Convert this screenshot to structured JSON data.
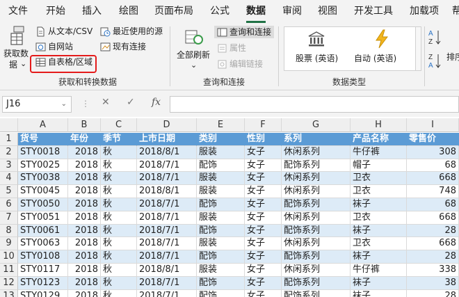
{
  "menu": {
    "tabs": [
      "文件",
      "开始",
      "插入",
      "绘图",
      "页面布局",
      "公式",
      "数据",
      "审阅",
      "视图",
      "开发工具",
      "加载项",
      "帮"
    ],
    "active_index": 6
  },
  "ribbon": {
    "get_data": {
      "label_line1": "获取数",
      "label_line2": "据",
      "chevron": "⌄"
    },
    "from_text_csv": "从文本/CSV",
    "from_web": "自网站",
    "from_table_range": "自表格/区域",
    "recent_sources": "最近使用的源",
    "existing_connections": "现有连接",
    "group_get_transform": "获取和转换数据",
    "refresh_all": {
      "label": "全部刷新",
      "chevron": "⌄"
    },
    "queries_connections": "查询和连接",
    "properties": "属性",
    "edit_links": "编辑链接",
    "group_queries": "查询和连接",
    "stocks": "股票 (英语)",
    "geography": "自动 (英语)",
    "group_data_types": "数据类型",
    "sort_az": "A\nZ",
    "sort_za": "Z\nA",
    "sort_label": "排序"
  },
  "formula_bar": {
    "name_box": "J16",
    "cancel": "✕",
    "enter": "✓",
    "fx": "fx"
  },
  "grid": {
    "columns": [
      "A",
      "B",
      "C",
      "D",
      "E",
      "F",
      "G",
      "H",
      "I"
    ],
    "row_numbers": [
      "1",
      "2",
      "3",
      "4",
      "5",
      "6",
      "7",
      "8",
      "9",
      "10",
      "11",
      "12",
      "13"
    ],
    "header": [
      "货号",
      "年份",
      "季节",
      "上市日期",
      "类别",
      "性别",
      "系列",
      "产品名称",
      "零售价"
    ],
    "rows": [
      [
        "STY0018",
        "2018",
        "秋",
        "2018/8/1",
        "服装",
        "女子",
        "休闲系列",
        "牛仔裤",
        "308"
      ],
      [
        "STY0025",
        "2018",
        "秋",
        "2018/7/1",
        "配饰",
        "女子",
        "配饰系列",
        "帽子",
        "68"
      ],
      [
        "STY0038",
        "2018",
        "秋",
        "2018/7/1",
        "服装",
        "女子",
        "休闲系列",
        "卫衣",
        "668"
      ],
      [
        "STY0045",
        "2018",
        "秋",
        "2018/8/1",
        "服装",
        "女子",
        "休闲系列",
        "卫衣",
        "748"
      ],
      [
        "STY0050",
        "2018",
        "秋",
        "2018/7/1",
        "配饰",
        "女子",
        "配饰系列",
        "袜子",
        "68"
      ],
      [
        "STY0051",
        "2018",
        "秋",
        "2018/7/1",
        "服装",
        "女子",
        "休闲系列",
        "卫衣",
        "668"
      ],
      [
        "STY0061",
        "2018",
        "秋",
        "2018/7/1",
        "配饰",
        "女子",
        "配饰系列",
        "袜子",
        "28"
      ],
      [
        "STY0063",
        "2018",
        "秋",
        "2018/7/1",
        "服装",
        "女子",
        "休闲系列",
        "卫衣",
        "668"
      ],
      [
        "STY0108",
        "2018",
        "秋",
        "2018/7/1",
        "配饰",
        "女子",
        "配饰系列",
        "袜子",
        "28"
      ],
      [
        "STY0117",
        "2018",
        "秋",
        "2018/8/1",
        "服装",
        "女子",
        "休闲系列",
        "牛仔裤",
        "338"
      ],
      [
        "STY0123",
        "2018",
        "秋",
        "2018/7/1",
        "配饰",
        "女子",
        "配饰系列",
        "袜子",
        "38"
      ],
      [
        "STY0129",
        "2018",
        "秋",
        "2018/7/1",
        "配饰",
        "女子",
        "配饰系列",
        "袜子",
        "28"
      ]
    ]
  },
  "colors": {
    "header_fill": "#5b9bd5",
    "band_fill": "#ddebf7",
    "accent_green": "#217346",
    "highlight_red": "#e41b1b"
  }
}
